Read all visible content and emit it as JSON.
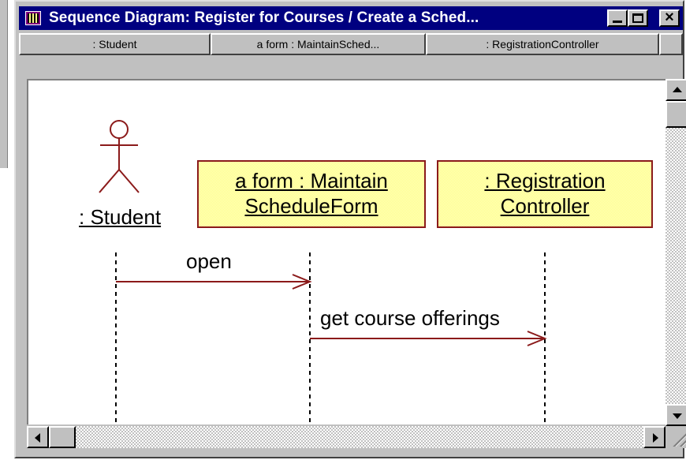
{
  "window": {
    "title": "Sequence Diagram: Register for Courses / Create a Sched...",
    "close_glyph": "×"
  },
  "column_headers": [
    ": Student",
    "a form : MaintainSched...",
    ": RegistrationController",
    ""
  ],
  "diagram": {
    "actor": {
      "label": ": Student"
    },
    "objects": [
      {
        "line1": "a form : Maintain",
        "line2": "ScheduleForm"
      },
      {
        "line1": ": Registration",
        "line2": "Controller"
      }
    ],
    "messages": [
      {
        "label": "open"
      },
      {
        "label": "get course offerings"
      }
    ]
  },
  "colors": {
    "title_bar": "#000080",
    "object_border": "#8b1a1a",
    "object_fill": "#ffffa0",
    "message_line": "#8b1a1a"
  },
  "icons": {
    "app_icon": "diagram-icon",
    "minimize": "minimize-icon",
    "maximize": "maximize-icon",
    "close": "close-icon"
  }
}
